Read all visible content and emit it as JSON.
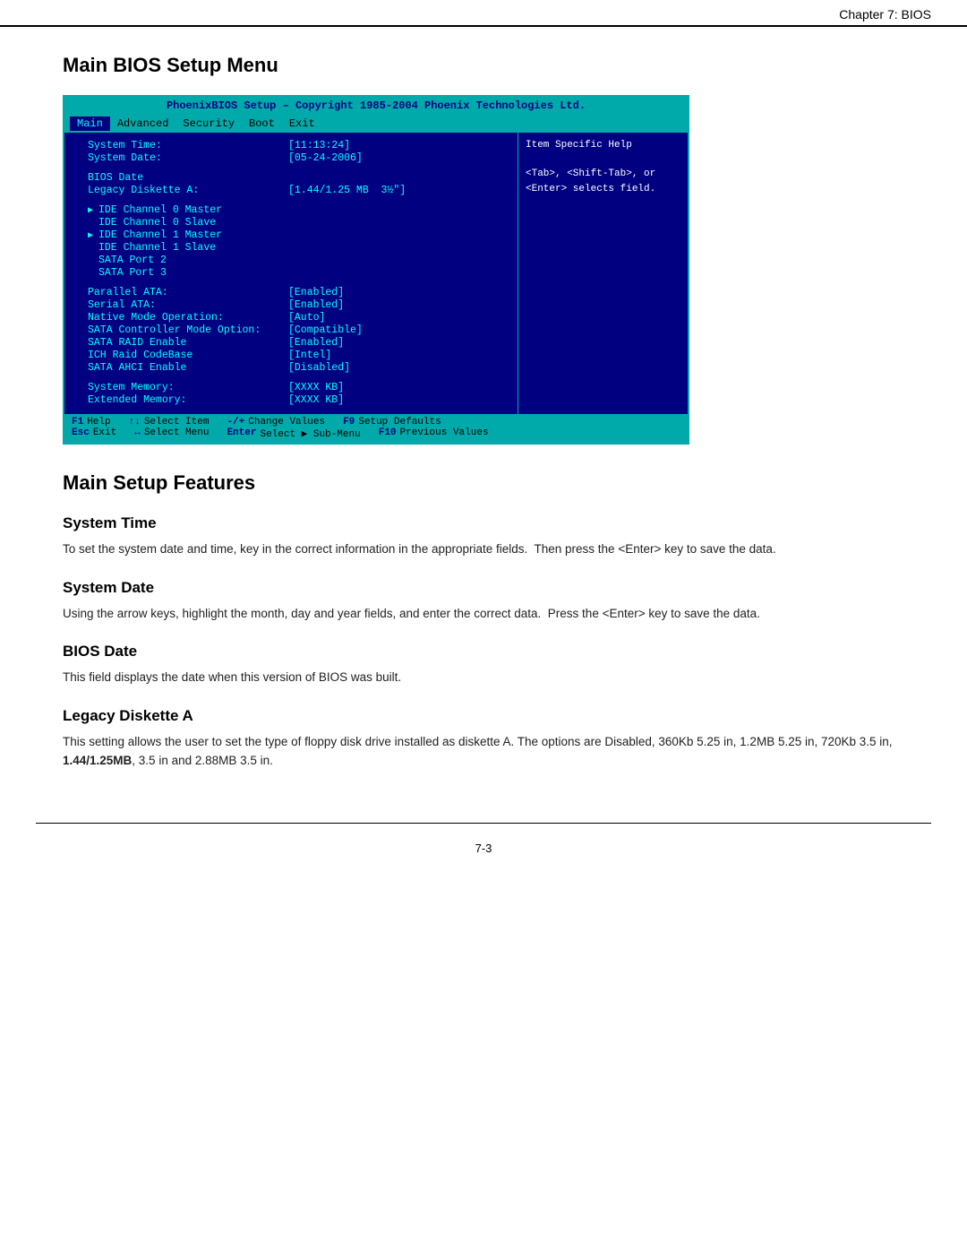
{
  "header": {
    "chapter": "Chapter 7: BIOS"
  },
  "bios_screen": {
    "title_bar": "PhoenixBIOS Setup – Copyright 1985-2004 Phoenix Technologies Ltd.",
    "menu_items": [
      "Main",
      "Advanced",
      "Security",
      "Boot",
      "Exit"
    ],
    "active_menu": "Main",
    "rows": [
      {
        "label": "System Time:",
        "value": "[11:13:24]",
        "indent": true
      },
      {
        "label": "System Date:",
        "value": "[05-24-2006]",
        "indent": true
      },
      {
        "spacer": true
      },
      {
        "label": "BIOS Date",
        "value": "",
        "indent": true
      },
      {
        "label": "Legacy Diskette A:",
        "value": "[1.44/1.25 MB  3½\"]",
        "indent": true
      },
      {
        "spacer": true
      },
      {
        "label": "IDE Channel 0 Master",
        "value": "",
        "arrow": true,
        "indent": true
      },
      {
        "label": "IDE Channel 0 Slave",
        "value": "",
        "indent": true
      },
      {
        "label": "IDE Channel 1 Master",
        "value": "",
        "arrow": true,
        "indent": true
      },
      {
        "label": "IDE Channel 1 Slave",
        "value": "",
        "indent": true
      },
      {
        "label": "SATA Port 2",
        "value": "",
        "indent": true
      },
      {
        "label": "SATA Port 3",
        "value": "",
        "indent": true
      },
      {
        "spacer": true
      },
      {
        "label": "Parallel ATA:",
        "value": "[Enabled]",
        "indent": true
      },
      {
        "label": "Serial ATA:",
        "value": "[Enabled]",
        "indent": true
      },
      {
        "label": "Native Mode Operation:",
        "value": "[Auto]",
        "indent": true
      },
      {
        "label": "SATA Controller Mode Option:",
        "value": "[Compatible]",
        "indent": true
      },
      {
        "label": "SATA RAID Enable",
        "value": "[Enabled]",
        "indent": true
      },
      {
        "label": "ICH Raid CodeBase",
        "value": "[Intel]",
        "indent": true
      },
      {
        "label": "SATA AHCI Enable",
        "value": "[Disabled]",
        "indent": true
      },
      {
        "spacer": true
      },
      {
        "label": "System Memory:",
        "value": "[XXXX KB]",
        "indent": true
      },
      {
        "label": "Extended Memory:",
        "value": "[XXXX KB]",
        "indent": true
      }
    ],
    "sidebar": {
      "title": "Item Specific Help",
      "text": "<Tab>, <Shift-Tab>, or\n<Enter> selects field."
    },
    "footer_rows": [
      [
        {
          "key": "F1",
          "desc": "Help"
        },
        {
          "key": "↑↓",
          "desc": "Select Item"
        },
        {
          "key": "-/+",
          "desc": "Change Values"
        },
        {
          "key": "F9",
          "desc": "Setup Defaults"
        }
      ],
      [
        {
          "key": "Esc",
          "desc": "Exit"
        },
        {
          "key": "↔",
          "desc": "Select Menu"
        },
        {
          "key": "Enter",
          "desc": "Select ▶ Sub-Menu"
        },
        {
          "key": "F10",
          "desc": "Previous Values"
        }
      ]
    ]
  },
  "main_section": {
    "title": "Main BIOS Setup Menu",
    "features_title": "Main Setup Features",
    "subsections": [
      {
        "title": "System Time",
        "text": "To set the system date and time, key in the correct information in the appropriate fields.  Then press the <Enter> key to save the data."
      },
      {
        "title": "System Date",
        "text": "Using the arrow keys, highlight the month, day and year fields, and enter the correct data.  Press the <Enter> key to save the data."
      },
      {
        "title": "BIOS Date",
        "text": "This field displays the date when this version of BIOS was built."
      },
      {
        "title": "Legacy Diskette A",
        "text": "This setting allows the user to set the type of floppy disk drive installed as diskette A. The options are Disabled, 360Kb 5.25 in, 1.2MB 5.25 in, 720Kb 3.5 in, 1.44/1.25MB, 3.5 in and 2.88MB 3.5 in.",
        "bold_part": "1.44/1.25MB"
      }
    ]
  },
  "footer": {
    "page_number": "7-3"
  }
}
